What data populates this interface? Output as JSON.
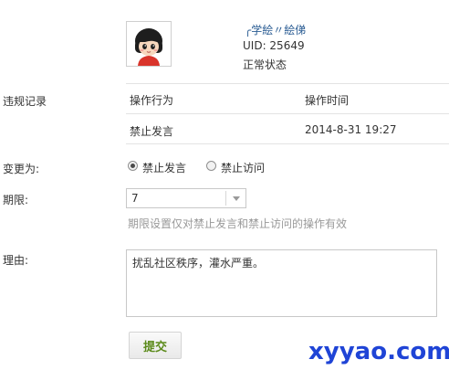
{
  "user": {
    "avatar_icon": "cartoon-girl-avatar",
    "name": "╭学絵〃絵俤",
    "uid": "UID: 25649",
    "status": "正常状态"
  },
  "violations": {
    "label": "违规记录",
    "headers": {
      "action": "操作行为",
      "time": "操作时间"
    },
    "rows": [
      {
        "action": "禁止发言",
        "time": "2014-8-31 19:27"
      }
    ]
  },
  "change_to": {
    "label": "变更为:",
    "options": [
      {
        "label": "禁止发言",
        "checked": true
      },
      {
        "label": "禁止访问",
        "checked": false
      }
    ]
  },
  "period": {
    "label": "期限:",
    "value": "7",
    "hint": "期限设置仅对禁止发言和禁止访问的操作有效"
  },
  "reason": {
    "label": "理由:",
    "value": "扰乱社区秩序，灌水严重。"
  },
  "submit_label": "提交",
  "watermark": "xyyao.com",
  "colors": {
    "link": "#2a5c93",
    "submit_text": "#5b8a1a",
    "watermark": "#1f44d6",
    "hint": "#999999"
  }
}
